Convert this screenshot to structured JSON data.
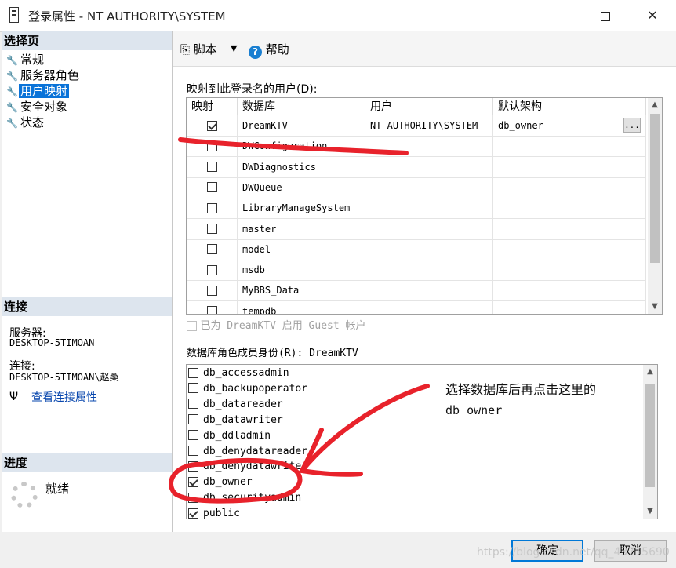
{
  "window": {
    "title": "登录属性 - NT AUTHORITY\\SYSTEM"
  },
  "left": {
    "select_page_header": "选择页",
    "nav": [
      {
        "label": "常规",
        "icon": "wrench-icon"
      },
      {
        "label": "服务器角色",
        "icon": "wrench-icon"
      },
      {
        "label": "用户映射",
        "icon": "wrench-icon",
        "selected": true
      },
      {
        "label": "安全对象",
        "icon": "wrench-icon"
      },
      {
        "label": "状态",
        "icon": "wrench-icon"
      }
    ],
    "connection_header": "连接",
    "server_label": "服务器:",
    "server_value": "DESKTOP-5TIMOAN",
    "connection_label": "连接:",
    "connection_value": "DESKTOP-5TIMOAN\\赵桑",
    "view_conn_link": "查看连接属性",
    "progress_header": "进度",
    "progress_status": "就绪"
  },
  "toolbar": {
    "script_label": "脚本",
    "help_label": "帮助"
  },
  "mapping": {
    "label": "映射到此登录名的用户(D):",
    "columns": [
      "映射",
      "数据库",
      "用户",
      "默认架构"
    ],
    "rows": [
      {
        "checked": true,
        "database": "DreamKTV",
        "user": "NT AUTHORITY\\SYSTEM",
        "schema": "db_owner"
      },
      {
        "checked": false,
        "database": "DWConfiguration",
        "user": "",
        "schema": ""
      },
      {
        "checked": false,
        "database": "DWDiagnostics",
        "user": "",
        "schema": ""
      },
      {
        "checked": false,
        "database": "DWQueue",
        "user": "",
        "schema": ""
      },
      {
        "checked": false,
        "database": "LibraryManageSystem",
        "user": "",
        "schema": ""
      },
      {
        "checked": false,
        "database": "master",
        "user": "",
        "schema": ""
      },
      {
        "checked": false,
        "database": "model",
        "user": "",
        "schema": ""
      },
      {
        "checked": false,
        "database": "msdb",
        "user": "",
        "schema": ""
      },
      {
        "checked": false,
        "database": "MyBBS_Data",
        "user": "",
        "schema": ""
      },
      {
        "checked": false,
        "database": "tempdb",
        "user": "",
        "schema": ""
      }
    ],
    "ellipsis": "..."
  },
  "guest": {
    "label": "已为 DreamKTV 启用 Guest 帐户"
  },
  "roles": {
    "label": "数据库角色成员身份(R): DreamKTV",
    "items": [
      {
        "name": "db_accessadmin",
        "checked": false
      },
      {
        "name": "db_backupoperator",
        "checked": false
      },
      {
        "name": "db_datareader",
        "checked": false
      },
      {
        "name": "db_datawriter",
        "checked": false
      },
      {
        "name": "db_ddladmin",
        "checked": false
      },
      {
        "name": "db_denydatareader",
        "checked": false
      },
      {
        "name": "db_denydatawriter",
        "checked": false
      },
      {
        "name": "db_owner",
        "checked": true
      },
      {
        "name": "db_securityadmin",
        "checked": false
      },
      {
        "name": "public",
        "checked": true
      }
    ]
  },
  "annotation": {
    "line1": "选择数据库后再点击这里的",
    "line2": "db_owner"
  },
  "buttons": {
    "ok": "确定",
    "cancel": "取消"
  },
  "watermark": "https://blog.csdn.net/qq_43715690",
  "colors": {
    "accent": "#0a73d8",
    "ink": "#e8222b"
  }
}
